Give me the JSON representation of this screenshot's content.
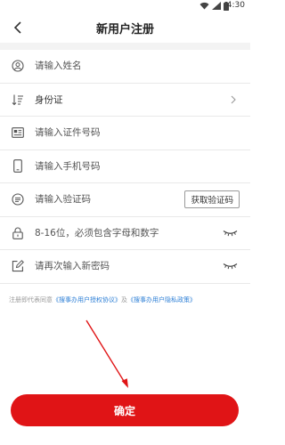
{
  "status_bar": {
    "time": "4:30"
  },
  "nav": {
    "title": "新用户注册"
  },
  "form": {
    "name_placeholder": "请输入姓名",
    "id_type_value": "身份证",
    "id_number_placeholder": "请输入证件号码",
    "phone_placeholder": "请输入手机号码",
    "code_placeholder": "请输入验证码",
    "get_code_label": "获取验证码",
    "password_placeholder": "8-16位，必须包含字母和数字",
    "confirm_password_placeholder": "请再次输入新密码"
  },
  "agreement": {
    "prefix": "注册即代表同意",
    "user_agreement": "《搜事办用户授权协议》",
    "conjunction": "及",
    "privacy_policy": "《搜事办用户隐私政策》"
  },
  "submit_label": "确定",
  "colors": {
    "accent": "#e01416",
    "link": "#2d7fd6"
  },
  "icons": [
    "back-icon",
    "user-icon",
    "sort-icon",
    "chevron-right-icon",
    "id-card-icon",
    "phone-icon",
    "message-icon",
    "lock-icon",
    "eye-closed-icon",
    "edit-icon",
    "wifi-icon",
    "signal-icon",
    "battery-icon"
  ]
}
